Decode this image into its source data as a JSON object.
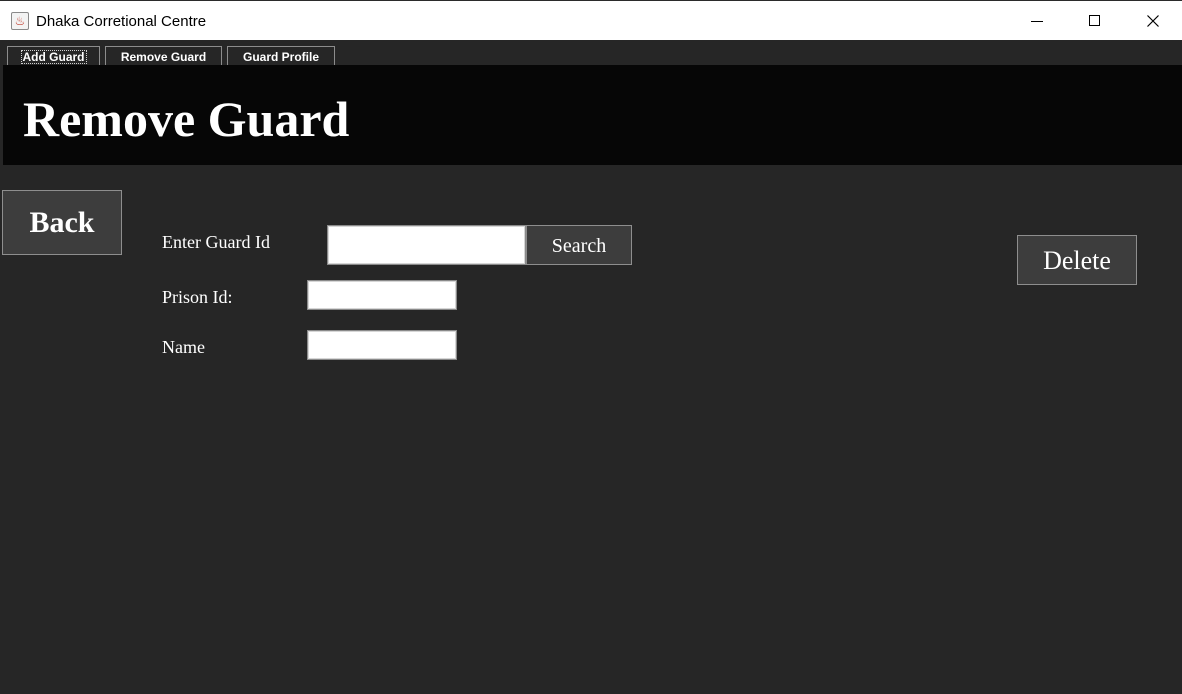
{
  "window": {
    "title": "Dhaka Corretional Centre",
    "icon": "java-cup-icon"
  },
  "tabs": [
    {
      "label": "Add Guard",
      "focused": true
    },
    {
      "label": "Remove Guard",
      "focused": false
    },
    {
      "label": "Guard Profile",
      "focused": false
    }
  ],
  "header": {
    "title": "Remove Guard"
  },
  "actions": {
    "back_label": "Back",
    "search_label": "Search",
    "delete_label": "Delete"
  },
  "form": {
    "guard_id_label": "Enter Guard Id",
    "guard_id_value": "",
    "prison_id_label": "Prison Id:",
    "prison_id_value": "",
    "name_label": "Name",
    "name_value": ""
  },
  "colors": {
    "background": "#262626",
    "banner": "#060606",
    "button": "#3d3d3d",
    "text": "#ffffff"
  }
}
